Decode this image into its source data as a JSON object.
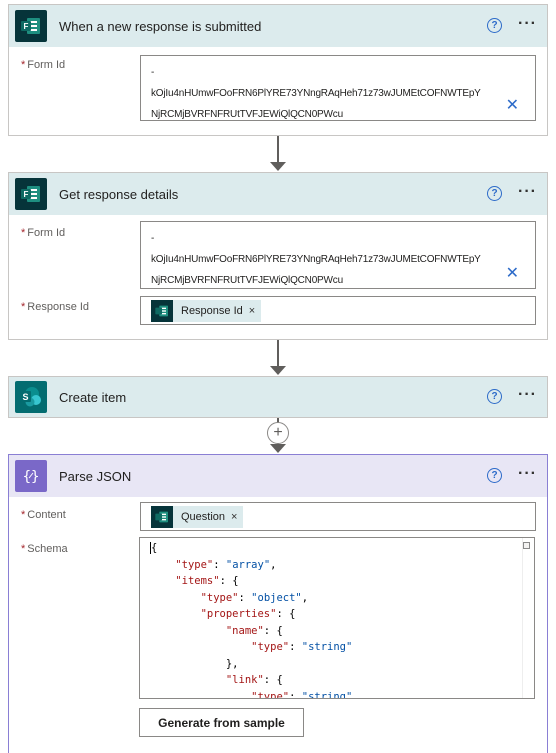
{
  "trigger": {
    "title": "When a new response is submitted",
    "form_id_label": "Form Id",
    "form_id_value_line1": "-",
    "form_id_value_line2": "kOjIu4nHUmwFOoFRN6PlYRE73YNngRAqHeh71z73wJUMEtCOFNWTEpY",
    "form_id_value_line3": "NjRCMjBVRFNFRUtTVFJEWiQlQCN0PWcu"
  },
  "get_details": {
    "title": "Get response details",
    "form_id_label": "Form Id",
    "form_id_value_line1": "-",
    "form_id_value_line2": "kOjIu4nHUmwFOoFRN6PlYRE73YNngRAqHeh71z73wJUMEtCOFNWTEpY",
    "form_id_value_line3": "NjRCMjBVRFNFRUtTVFJEWiQlQCN0PWcu",
    "response_id_label": "Response Id",
    "response_id_token": "Response Id"
  },
  "create_item": {
    "title": "Create item"
  },
  "parse_json": {
    "title": "Parse JSON",
    "content_label": "Content",
    "content_token": "Question",
    "schema_label": "Schema",
    "generate_button": "Generate from sample"
  },
  "common": {
    "required_mark": "*",
    "help_glyph": "?",
    "more_glyph": "···",
    "clear_glyph": "✕",
    "token_remove_glyph": "×",
    "insert_step_glyph": "+"
  },
  "colors": {
    "forms_dark": "#06343a",
    "forms_header": "#dcebed",
    "sharepoint": "#036c70",
    "json_header": "#e8e6f5",
    "json_icon": "#7a68c8",
    "link_blue": "#2d6bc9",
    "required_red": "#a4262c"
  },
  "icons": {
    "forms": "microsoft-forms-icon",
    "sharepoint": "sharepoint-icon",
    "json": "curly-braces-icon"
  }
}
